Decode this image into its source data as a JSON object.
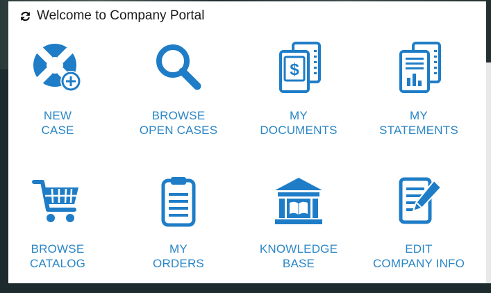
{
  "header": {
    "title": "Welcome to Company Portal"
  },
  "colors": {
    "accent": "#1f7dc7",
    "label": "#2a86c6"
  },
  "tiles": [
    {
      "icon": "lifebuoy-plus-icon",
      "line1": "NEW",
      "line2": "CASE"
    },
    {
      "icon": "search-icon",
      "line1": "BROWSE",
      "line2": "OPEN CASES"
    },
    {
      "icon": "documents-dollar-icon",
      "line1": "MY",
      "line2": "DOCUMENTS"
    },
    {
      "icon": "statements-chart-icon",
      "line1": "MY",
      "line2": "STATEMENTS"
    },
    {
      "icon": "shopping-cart-icon",
      "line1": "BROWSE",
      "line2": "CATALOG"
    },
    {
      "icon": "clipboard-icon",
      "line1": "MY",
      "line2": "ORDERS"
    },
    {
      "icon": "library-book-icon",
      "line1": "KNOWLEDGE",
      "line2": "BASE"
    },
    {
      "icon": "edit-document-icon",
      "line1": "EDIT",
      "line2": "COMPANY INFO"
    }
  ]
}
